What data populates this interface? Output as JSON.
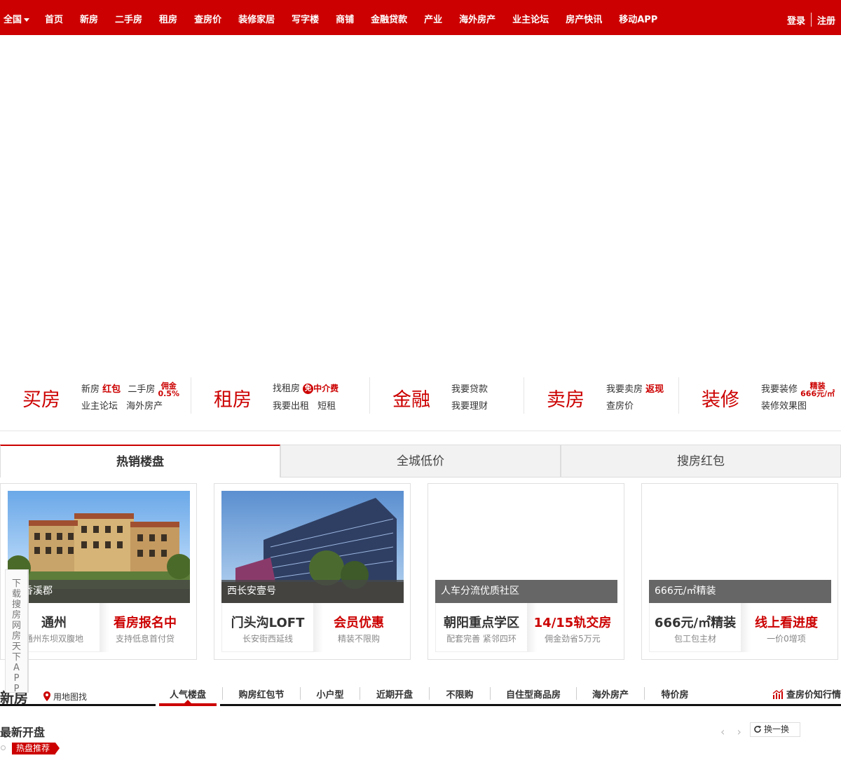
{
  "nav": {
    "city": "全国",
    "items": [
      "首页",
      "新房",
      "二手房",
      "租房",
      "查房价",
      "装修家居",
      "写字楼",
      "商铺",
      "金融贷款",
      "产业",
      "海外房产",
      "业主论坛",
      "房产快讯",
      "移动APP"
    ],
    "login": "登录",
    "register": "注册"
  },
  "services": {
    "buy": {
      "title": "买房",
      "new": "新房",
      "new_tag": "红包",
      "second": "二手房",
      "second_tag1": "佣金",
      "second_tag2": "0.5%",
      "forum": "业主论坛",
      "overseas": "海外房产"
    },
    "rent": {
      "title": "租房",
      "find": "找租房",
      "free_icon": "免",
      "free_tag": "中介费",
      "out": "我要出租",
      "short": "短租"
    },
    "finance": {
      "title": "金融",
      "loan": "我要贷款",
      "wealth": "我要理财"
    },
    "sell": {
      "title": "卖房",
      "sell": "我要卖房",
      "sell_tag": "返现",
      "price": "查房价"
    },
    "deco": {
      "title": "装修",
      "deco": "我要装修",
      "deco_tag1": "精装",
      "deco_tag2": "666元/㎡",
      "effect": "装修效果图"
    }
  },
  "tabs": [
    "热销楼盘",
    "全城低价",
    "搜房红包"
  ],
  "cards": [
    {
      "caption": "开香溪郡",
      "left_title": "通州",
      "left_sub": "通州东坝双腹地",
      "right_title": "看房报名中",
      "right_sub": "支持低息首付贷"
    },
    {
      "caption": "西长安壹号",
      "left_title": "门头沟LOFT",
      "left_sub": "长安街西延线",
      "right_title": "会员优惠",
      "right_sub": "精装不限购"
    },
    {
      "caption": "人车分流优质社区",
      "left_title": "朝阳重点学区",
      "left_sub": "配套完善 紧邻四环",
      "right_title": "14/15轨交房",
      "right_sub": "佣金劲省5万元"
    },
    {
      "caption": "666元/㎡精装",
      "left_title": "666元/㎡精装",
      "left_sub": "包工包主材",
      "right_title": "线上看进度",
      "right_sub": "一价0增项"
    }
  ],
  "app_side": "下载搜房网房天下APP",
  "newhouse": {
    "title": "新房",
    "map_search": "用地图找",
    "tabs": [
      "人气楼盘",
      "购房红包节",
      "小户型",
      "近期开盘",
      "不限购",
      "自住型商品房",
      "海外房产",
      "特价房"
    ],
    "trend": "查房价知行情"
  },
  "latest": {
    "title": "最新开盘",
    "prev": "‹",
    "next": "›",
    "swap": "换一换",
    "hot": "热盘推荐"
  },
  "colors": {
    "brand": "#cc0000"
  }
}
